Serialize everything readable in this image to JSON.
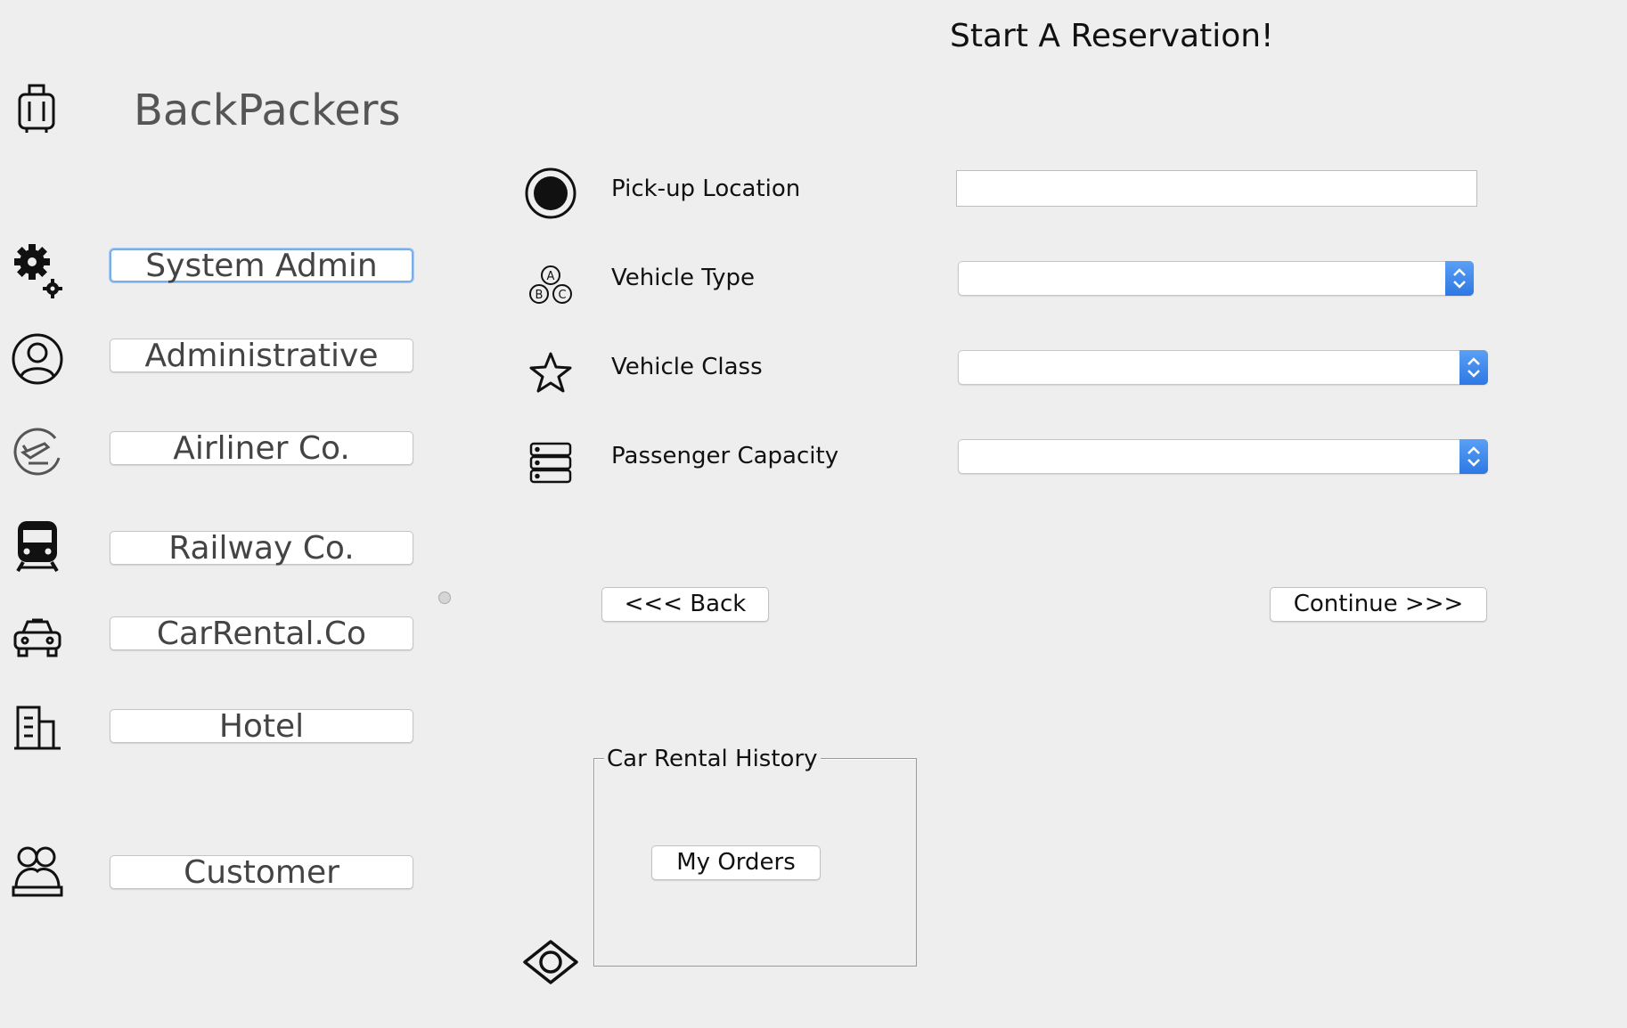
{
  "sidebar": {
    "brand": "BackPackers",
    "items": [
      {
        "label": "System Admin",
        "icon": "gear-icon"
      },
      {
        "label": "Administrative",
        "icon": "user-circle-icon"
      },
      {
        "label": "Airliner Co.",
        "icon": "airplane-icon"
      },
      {
        "label": "Railway Co.",
        "icon": "train-icon"
      },
      {
        "label": "CarRental.Co",
        "icon": "car-icon"
      },
      {
        "label": "Hotel",
        "icon": "building-icon"
      },
      {
        "label": "Customer",
        "icon": "group-icon"
      }
    ]
  },
  "main": {
    "title": "Start A Reservation!",
    "fields": {
      "pickup": {
        "label": "Pick-up Location",
        "value": "",
        "icon": "radio-dot-icon"
      },
      "vehicle_type": {
        "label": "Vehicle Type",
        "value": "",
        "icon": "abc-bubbles-icon"
      },
      "vehicle_class": {
        "label": "Vehicle Class",
        "value": "",
        "icon": "star-icon"
      },
      "passenger_capacity": {
        "label": "Passenger Capacity",
        "value": "",
        "icon": "server-stack-icon"
      }
    },
    "back_label": "<<< Back",
    "continue_label": "Continue >>>",
    "history": {
      "title": "Car Rental History",
      "my_orders_label": "My Orders"
    },
    "eye_icon": "eye-icon"
  },
  "colors": {
    "background": "#eeeeee",
    "accent": "#2d78e4",
    "focus": "#7aaee8"
  }
}
